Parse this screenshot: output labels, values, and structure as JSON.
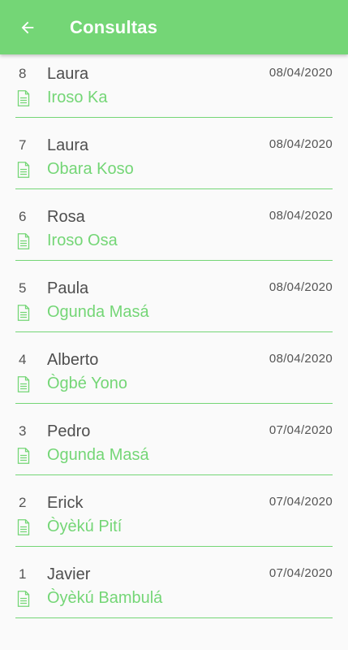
{
  "app": {
    "title": "Consultas",
    "back_icon": "arrow-left-icon",
    "accent_color": "#74d676"
  },
  "consultations": [
    {
      "number": "8",
      "name": "Laura",
      "date": "08/04/2020",
      "subtitle": "Iroso Ka",
      "icon": "document-icon"
    },
    {
      "number": "7",
      "name": "Laura",
      "date": "08/04/2020",
      "subtitle": "Obara Koso",
      "icon": "document-icon"
    },
    {
      "number": "6",
      "name": "Rosa",
      "date": "08/04/2020",
      "subtitle": "Iroso Osa",
      "icon": "document-icon"
    },
    {
      "number": "5",
      "name": "Paula",
      "date": "08/04/2020",
      "subtitle": "Ogunda Masá",
      "icon": "document-icon"
    },
    {
      "number": "4",
      "name": "Alberto",
      "date": "08/04/2020",
      "subtitle": "Ògbé Yono",
      "icon": "document-icon"
    },
    {
      "number": "3",
      "name": "Pedro",
      "date": "07/04/2020",
      "subtitle": "Ogunda Masá",
      "icon": "document-icon"
    },
    {
      "number": "2",
      "name": "Erick",
      "date": "07/04/2020",
      "subtitle": "Òyèkú Pití",
      "icon": "document-icon"
    },
    {
      "number": "1",
      "name": "Javier",
      "date": "07/04/2020",
      "subtitle": "Òyèkú Bambulá",
      "icon": "document-icon"
    }
  ]
}
